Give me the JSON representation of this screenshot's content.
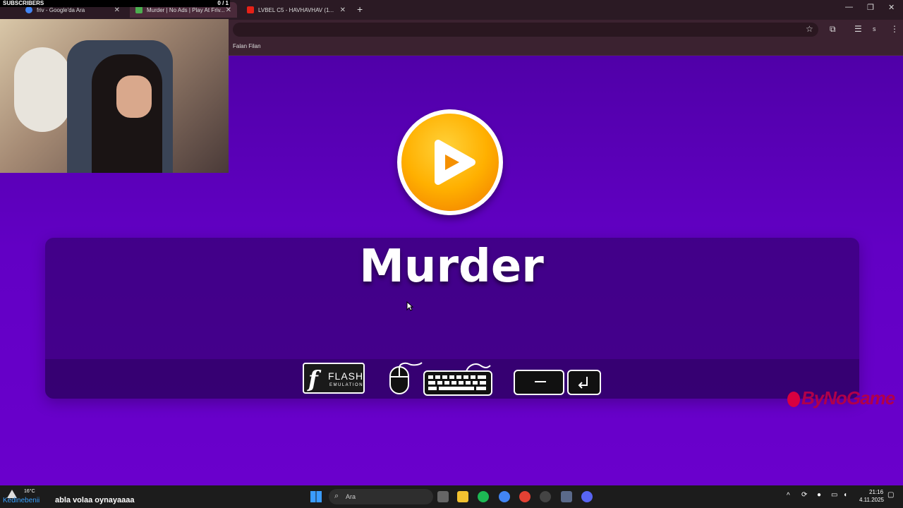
{
  "tabs": [
    {
      "title": "friv - Google'da Ara"
    },
    {
      "title": "Murder | No Ads | Play At Friv..."
    },
    {
      "title": "LVBEL C5 - HAVHAVHAV (1..."
    }
  ],
  "bookmarks": [
    {
      "label": "Falan Filan"
    }
  ],
  "profile_initial": "s",
  "stream_overlay": {
    "subscribers_label": "SUBSCRIBERS",
    "subscribers_count": "0 / 1"
  },
  "game": {
    "title": "Murder",
    "flash_badge": {
      "line1": "FLASH",
      "line2": "EMULATION"
    },
    "watermark": "ByNoGame",
    "keys": [
      "space-key-icon",
      "enter-key-icon"
    ]
  },
  "taskbar": {
    "weather_temp": "16°C",
    "chat_user": "Kedinebenii",
    "chat_message": "abla volaa oynayaaaa",
    "search_placeholder": "Ara",
    "time": "21:16",
    "date": "4.11.2025"
  },
  "colors": {
    "game_bg": "#6200c4",
    "play_button": "#ffb000",
    "watermark": "#b0004a"
  }
}
